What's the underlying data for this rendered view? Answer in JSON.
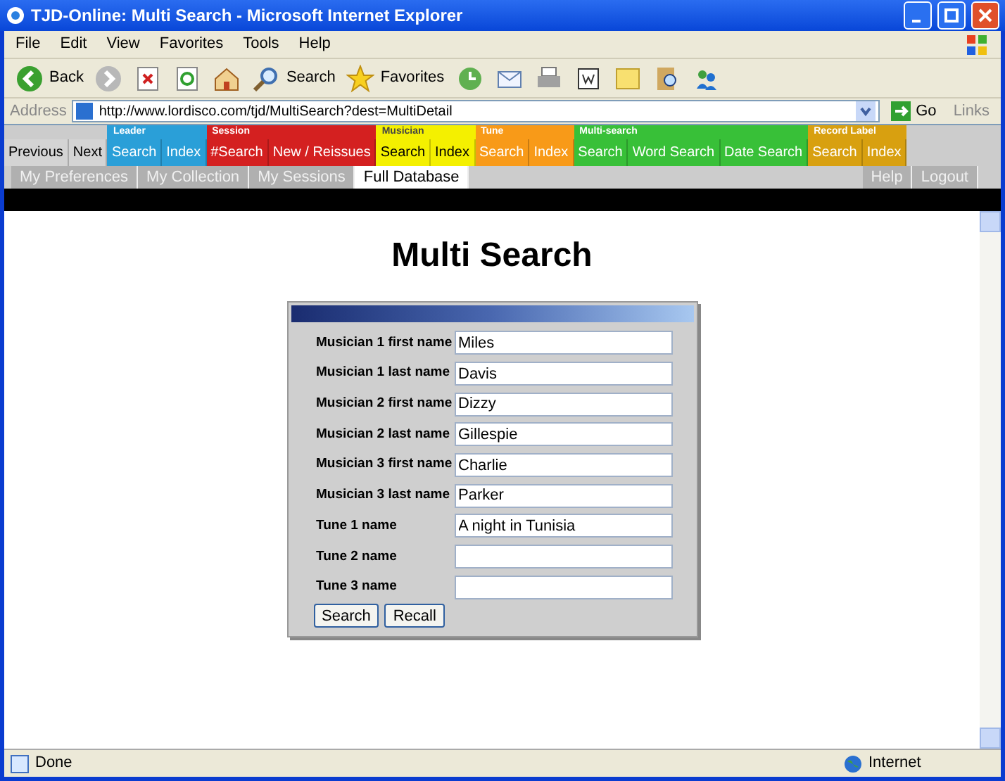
{
  "window": {
    "title": "TJD-Online: Multi Search - Microsoft Internet Explorer"
  },
  "menu": [
    "File",
    "Edit",
    "View",
    "Favorites",
    "Tools",
    "Help"
  ],
  "toolbar": {
    "back": "Back",
    "search": "Search",
    "favorites": "Favorites"
  },
  "address_bar": {
    "label": "Address",
    "url": "http://www.lordisco.com/tjd/MultiSearch?dest=MultiDetail",
    "go": "Go",
    "links": "Links"
  },
  "nav": {
    "left": [
      "Previous",
      "Next"
    ],
    "groups": [
      {
        "label": "Leader",
        "color": "#2a9fd8",
        "dark_text": false,
        "items": [
          "Search",
          "Index"
        ]
      },
      {
        "label": "Session",
        "color": "#d42020",
        "dark_text": false,
        "items": [
          "#Search",
          "New / Reissues"
        ]
      },
      {
        "label": "Musician",
        "color": "#f4f000",
        "dark_text": true,
        "items": [
          "Search",
          "Index"
        ]
      },
      {
        "label": "Tune",
        "color": "#f89a18",
        "dark_text": false,
        "items": [
          "Search",
          "Index"
        ]
      },
      {
        "label": "Multi-search",
        "color": "#38c038",
        "dark_text": false,
        "items": [
          "Search",
          "Word Search",
          "Date Search"
        ]
      },
      {
        "label": "Record Label",
        "color": "#d8a010",
        "dark_text": false,
        "items": [
          "Search",
          "Index"
        ]
      }
    ]
  },
  "subnav": {
    "items": [
      {
        "label": "My Preferences",
        "selected": false
      },
      {
        "label": "My Collection",
        "selected": false
      },
      {
        "label": "My Sessions",
        "selected": false
      },
      {
        "label": "Full Database",
        "selected": true
      }
    ],
    "right": [
      "Help",
      "Logout"
    ]
  },
  "page": {
    "heading": "Multi Search",
    "fields": [
      {
        "label": "Musician 1 first name",
        "value": "Miles"
      },
      {
        "label": "Musician 1 last name",
        "value": "Davis"
      },
      {
        "label": "Musician 2 first name",
        "value": "Dizzy"
      },
      {
        "label": "Musician 2 last name",
        "value": "Gillespie"
      },
      {
        "label": "Musician 3 first name",
        "value": "Charlie"
      },
      {
        "label": "Musician 3 last name",
        "value": "Parker"
      },
      {
        "label": "Tune 1 name",
        "value": "A night in Tunisia"
      },
      {
        "label": "Tune 2 name"
      },
      {
        "label": "Tune 3 name"
      }
    ],
    "buttons": [
      "Search",
      "Recall"
    ]
  },
  "status_bar": {
    "text": "Done",
    "zone": "Internet"
  }
}
